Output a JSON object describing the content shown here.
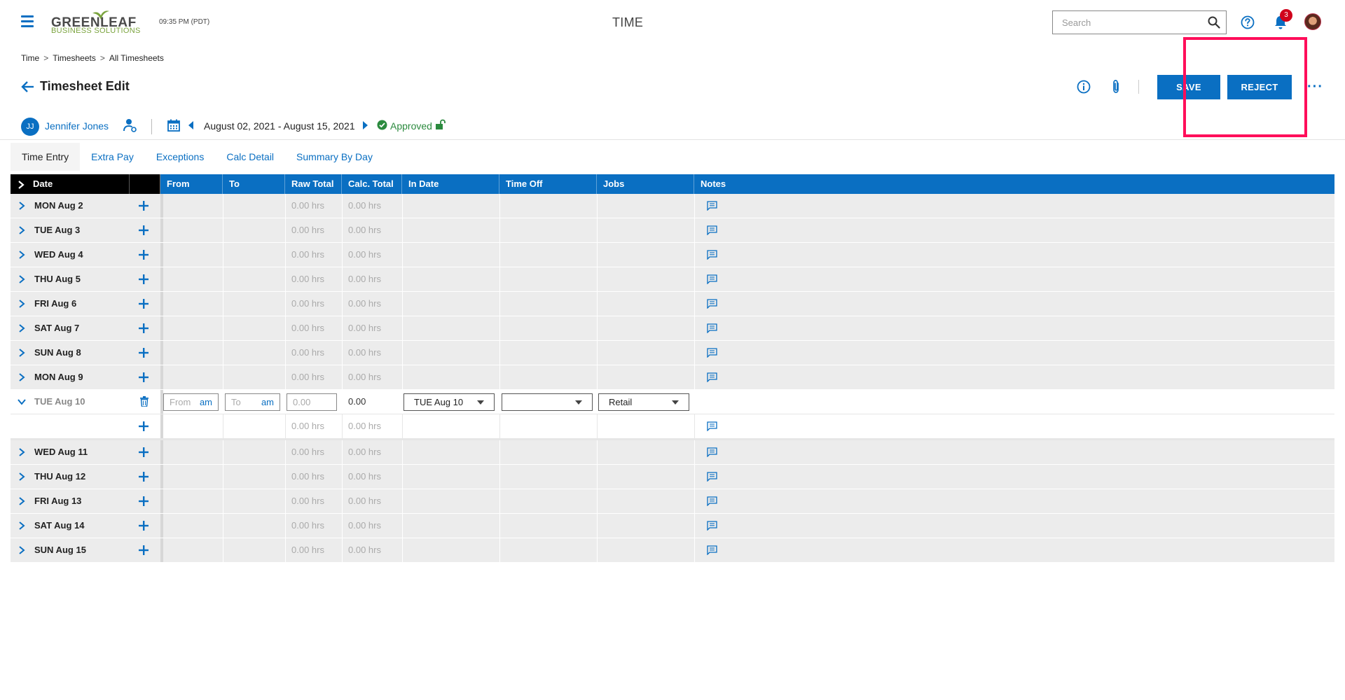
{
  "header": {
    "logo_main": "GREENLEAF",
    "logo_sub": "BUSINESS SOLUTIONS",
    "clock": "09:35 PM (PDT)",
    "app_title": "TIME",
    "search_placeholder": "Search",
    "notification_count": "3"
  },
  "breadcrumb": [
    "Time",
    "Timesheets",
    "All Timesheets"
  ],
  "breadcrumb_sep": ">",
  "page": {
    "title": "Timesheet Edit",
    "save_label": "SAVE",
    "reject_label": "REJECT",
    "more_label": "···"
  },
  "employee": {
    "initials": "JJ",
    "name": "Jennifer Jones",
    "date_range": "August 02, 2021 - August 15, 2021",
    "status": "Approved"
  },
  "tabs": [
    "Time Entry",
    "Extra Pay",
    "Exceptions",
    "Calc Detail",
    "Summary By Day"
  ],
  "table": {
    "columns": [
      "Date",
      "From",
      "To",
      "Raw Total",
      "Calc. Total",
      "In Date",
      "Time Off",
      "Jobs",
      "Notes"
    ],
    "rows": [
      {
        "label": "MON Aug 2",
        "raw": "0.00 hrs",
        "calc": "0.00 hrs"
      },
      {
        "label": "TUE Aug 3",
        "raw": "0.00 hrs",
        "calc": "0.00 hrs"
      },
      {
        "label": "WED Aug 4",
        "raw": "0.00 hrs",
        "calc": "0.00 hrs"
      },
      {
        "label": "THU Aug 5",
        "raw": "0.00 hrs",
        "calc": "0.00 hrs"
      },
      {
        "label": "FRI Aug 6",
        "raw": "0.00 hrs",
        "calc": "0.00 hrs"
      },
      {
        "label": "SAT Aug 7",
        "raw": "0.00 hrs",
        "calc": "0.00 hrs"
      },
      {
        "label": "SUN Aug 8",
        "raw": "0.00 hrs",
        "calc": "0.00 hrs"
      },
      {
        "label": "MON Aug 9",
        "raw": "0.00 hrs",
        "calc": "0.00 hrs"
      }
    ],
    "expanded": {
      "label": "TUE Aug 10",
      "from_placeholder": "From",
      "from_ampm": "am",
      "to_placeholder": "To",
      "to_ampm": "am",
      "raw_placeholder": "0.00",
      "calc_value": "0.00",
      "in_date": "TUE Aug 10",
      "time_off": "",
      "job": "Retail",
      "sub_raw": "0.00 hrs",
      "sub_calc": "0.00 hrs"
    },
    "rows_after": [
      {
        "label": "WED Aug 11",
        "raw": "0.00 hrs",
        "calc": "0.00 hrs"
      },
      {
        "label": "THU Aug 12",
        "raw": "0.00 hrs",
        "calc": "0.00 hrs"
      },
      {
        "label": "FRI Aug 13",
        "raw": "0.00 hrs",
        "calc": "0.00 hrs"
      },
      {
        "label": "SAT Aug 14",
        "raw": "0.00 hrs",
        "calc": "0.00 hrs"
      },
      {
        "label": "SUN Aug 15",
        "raw": "0.00 hrs",
        "calc": "0.00 hrs"
      }
    ]
  },
  "colors": {
    "accent": "#0a6fc2",
    "approved": "#2b8a3e",
    "badge": "#d0021b",
    "highlight": "#ff0e5a"
  }
}
